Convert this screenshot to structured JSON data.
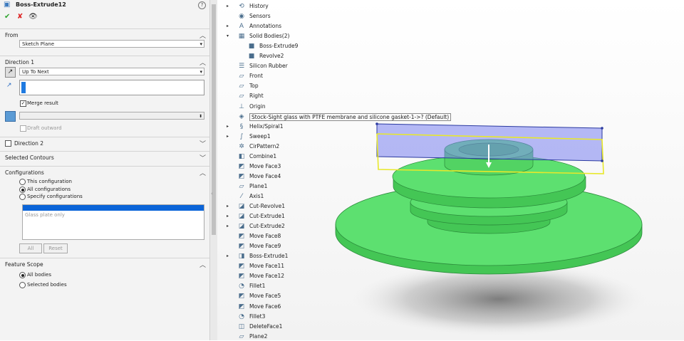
{
  "property_manager": {
    "title": "Boss-Extrude12",
    "help_label": "?",
    "from": {
      "header": "From",
      "value": "Sketch Plane"
    },
    "direction1": {
      "header": "Direction 1",
      "end_condition": "Up To Next",
      "merge_result": "Merge result",
      "draft_outward": "Draft outward"
    },
    "direction2": {
      "header": "Direction 2"
    },
    "selected_contours": {
      "header": "Selected Contours"
    },
    "configurations": {
      "header": "Configurations",
      "options": [
        "This configuration",
        "All configurations",
        "Specify configurations"
      ],
      "selected_option": "All configurations",
      "list_items": [
        "",
        "Glass plate only"
      ],
      "all_button": "All",
      "reset_button": "Reset"
    },
    "feature_scope": {
      "header": "Feature Scope",
      "options": [
        "All bodies",
        "Selected bodies"
      ],
      "selected_option": "All bodies"
    }
  },
  "feature_tree": {
    "nodes": [
      {
        "label": "History",
        "icon": "history-icon",
        "expandable": true
      },
      {
        "label": "Sensors",
        "icon": "sensor-icon",
        "expandable": false
      },
      {
        "label": "Annotations",
        "icon": "annotation-icon",
        "expandable": true
      },
      {
        "label": "Solid Bodies(2)",
        "icon": "solid-bodies-icon",
        "expandable": true,
        "expanded": true
      },
      {
        "label": "Boss-Extrude9",
        "icon": "body-icon",
        "child": true
      },
      {
        "label": "Revolve2",
        "icon": "body-icon",
        "child": true
      },
      {
        "label": "Silicon Rubber",
        "icon": "material-icon"
      },
      {
        "label": "Front",
        "icon": "plane-icon"
      },
      {
        "label": "Top",
        "icon": "plane-icon"
      },
      {
        "label": "Right",
        "icon": "plane-icon"
      },
      {
        "label": "Origin",
        "icon": "origin-icon"
      },
      {
        "label": "Stock-Sight glass with PTFE membrane and silicone gasket-1->? (Default)",
        "icon": "derived-part-icon",
        "highlight": true
      },
      {
        "label": "Helix/Spiral1",
        "icon": "helix-icon",
        "expandable": true
      },
      {
        "label": "Sweep1",
        "icon": "sweep-icon",
        "expandable": true
      },
      {
        "label": "CirPattern2",
        "icon": "pattern-icon"
      },
      {
        "label": "Combine1",
        "icon": "combine-icon"
      },
      {
        "label": "Move Face3",
        "icon": "move-face-icon"
      },
      {
        "label": "Move Face4",
        "icon": "move-face-icon"
      },
      {
        "label": "Plane1",
        "icon": "plane-icon"
      },
      {
        "label": "Axis1",
        "icon": "axis-icon"
      },
      {
        "label": "Cut-Revolve1",
        "icon": "cut-icon",
        "expandable": true
      },
      {
        "label": "Cut-Extrude1",
        "icon": "cut-icon",
        "expandable": true
      },
      {
        "label": "Cut-Extrude2",
        "icon": "cut-icon",
        "expandable": true
      },
      {
        "label": "Move Face8",
        "icon": "move-face-icon"
      },
      {
        "label": "Move Face9",
        "icon": "move-face-icon"
      },
      {
        "label": "Boss-Extrude1",
        "icon": "extrude-icon",
        "expandable": true
      },
      {
        "label": "Move Face11",
        "icon": "move-face-icon"
      },
      {
        "label": "Move Face12",
        "icon": "move-face-icon"
      },
      {
        "label": "Fillet1",
        "icon": "fillet-icon"
      },
      {
        "label": "Move Face5",
        "icon": "move-face-icon"
      },
      {
        "label": "Move Face6",
        "icon": "move-face-icon"
      },
      {
        "label": "Fillet3",
        "icon": "fillet-icon"
      },
      {
        "label": "DeleteFace1",
        "icon": "delete-face-icon"
      },
      {
        "label": "Plane2",
        "icon": "plane-icon"
      }
    ]
  },
  "colors": {
    "part_green": "#5de070",
    "part_edge": "#2a8a3a",
    "preview_blue": "#8a90e8",
    "preview_outline": "#e6e62a",
    "selection_blue": "#0a64d8"
  }
}
